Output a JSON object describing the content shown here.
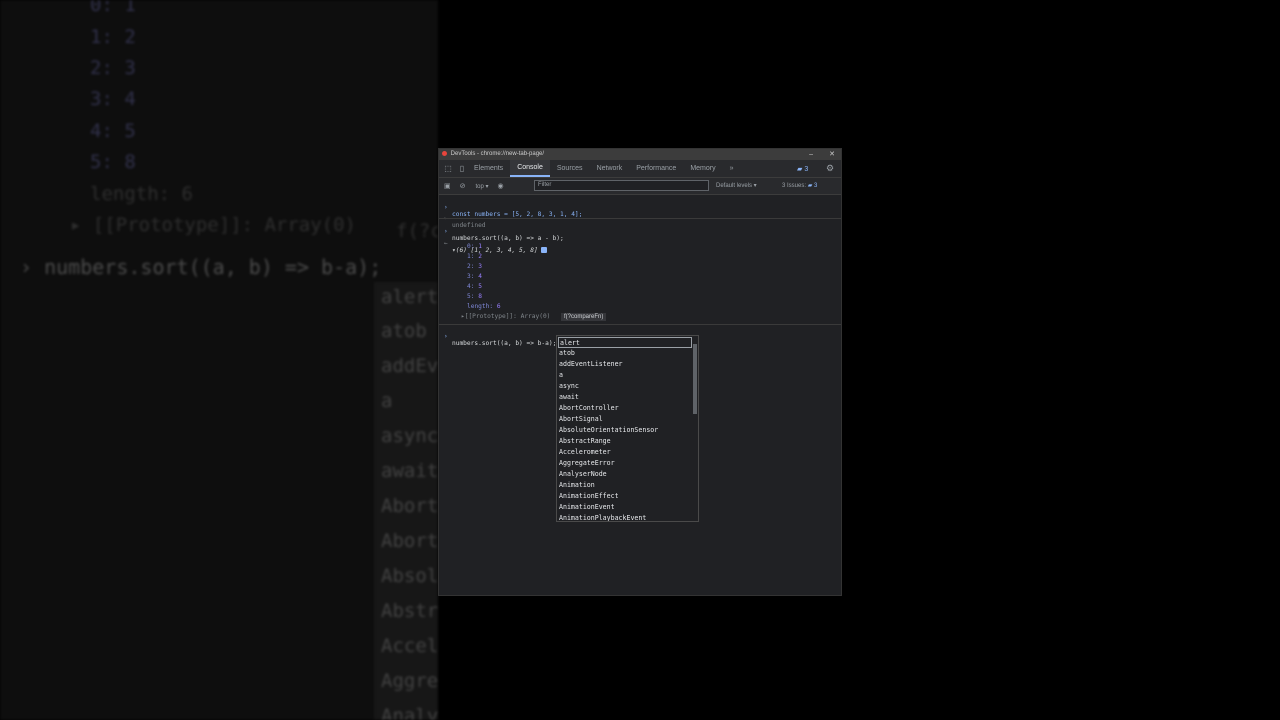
{
  "background_zoom": {
    "lines": [
      "0: 1",
      "1: 2",
      "2: 3",
      "3: 4",
      "4: 5",
      "5: 8"
    ],
    "length_line": "length: 6",
    "prototype_line": "▸ [[Prototype]]: Array(0)",
    "hint_fragment": "f(?c",
    "command": "numbers.sort((a, b) => b-a);",
    "ac_items": [
      "alert",
      "atob",
      "addEv",
      "a",
      "async",
      "await",
      "Abort",
      "Abort",
      "Absol",
      "Abstr",
      "Accel",
      "Aggre",
      "Analy"
    ]
  },
  "window": {
    "title": "DevTools - chrome://new-tab-page/",
    "minimize": "–",
    "close": "✕"
  },
  "tabs": [
    {
      "label": "Elements"
    },
    {
      "label": "Console",
      "active": true
    },
    {
      "label": "Sources"
    },
    {
      "label": "Network"
    },
    {
      "label": "Performance"
    },
    {
      "label": "Memory"
    }
  ],
  "tab_overflow": "»",
  "message_count": "3",
  "toolbar": {
    "context": "top ▾",
    "filter_placeholder": "Filter",
    "levels": "Default levels ▾",
    "issues_label": "3 Issues:",
    "issues_count": "3"
  },
  "console": {
    "line1_code": "const numbers = [5, 2, 8, 3, 1, 4];",
    "line1_result": "undefined",
    "line2_code": "numbers.sort((a, b) => a - b);",
    "line2_result_head": "▾(6) [1, 2, 3, 4, 5, 8]",
    "entries": [
      {
        "key": "0",
        "value": "1"
      },
      {
        "key": "1",
        "value": "2"
      },
      {
        "key": "2",
        "value": "3"
      },
      {
        "key": "3",
        "value": "4"
      },
      {
        "key": "4",
        "value": "5"
      },
      {
        "key": "5",
        "value": "8"
      }
    ],
    "length_key": "length",
    "length_value": "6",
    "prototype_label": "▸[[Prototype]]: Array(0)",
    "hint": "f(?compareFn)",
    "input_code": "numbers.sort((a, b) => b-a);"
  },
  "autocomplete": [
    "alert",
    "atob",
    "addEventListener",
    "a",
    "async",
    "await",
    "AbortController",
    "AbortSignal",
    "AbsoluteOrientationSensor",
    "AbstractRange",
    "Accelerometer",
    "AggregateError",
    "AnalyserNode",
    "Animation",
    "AnimationEffect",
    "AnimationEvent",
    "AnimationPlaybackEvent"
  ],
  "colors": {
    "accent": "#8ab4f8",
    "background": "#202124"
  }
}
